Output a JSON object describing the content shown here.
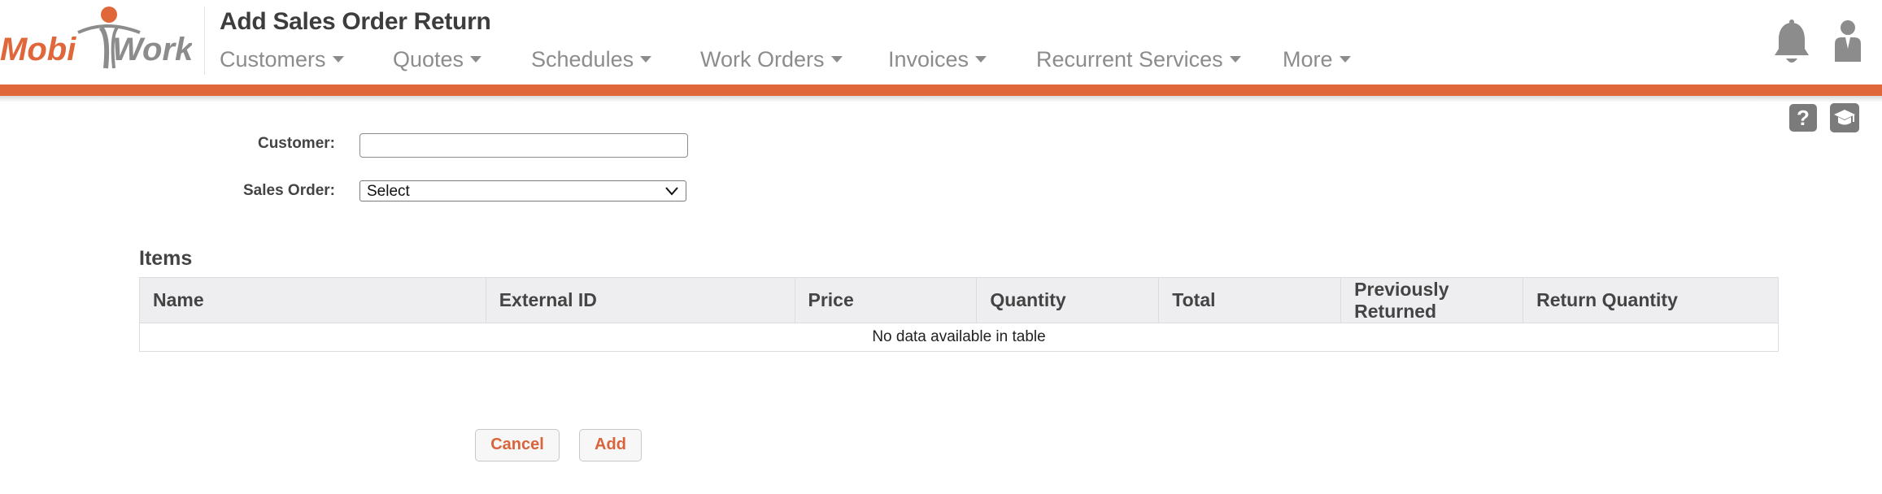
{
  "brand": {
    "logo_text_left": "Mobi",
    "logo_text_right": "Work",
    "orange": "#e0673a",
    "gray": "#8c8c8c"
  },
  "header": {
    "title": "Add Sales Order Return",
    "nav": [
      {
        "label": "Customers"
      },
      {
        "label": "Quotes"
      },
      {
        "label": "Schedules"
      },
      {
        "label": "Work Orders"
      },
      {
        "label": "Invoices"
      },
      {
        "label": "Recurrent Services"
      },
      {
        "label": "More"
      }
    ],
    "icons": [
      "bell-icon",
      "user-icon"
    ]
  },
  "toolbar": {
    "icons": [
      "help-icon",
      "training-icon"
    ],
    "help_glyph": "?"
  },
  "form": {
    "customer_label": "Customer:",
    "customer_value": "",
    "sales_order_label": "Sales Order:",
    "sales_order_value": "Select"
  },
  "items": {
    "heading": "Items",
    "columns": [
      "Name",
      "External ID",
      "Price",
      "Quantity",
      "Total",
      "Previously Returned",
      "Return Quantity"
    ],
    "rows": [],
    "empty_message": "No data available in table"
  },
  "buttons": {
    "cancel_label": "Cancel",
    "add_label": "Add"
  }
}
